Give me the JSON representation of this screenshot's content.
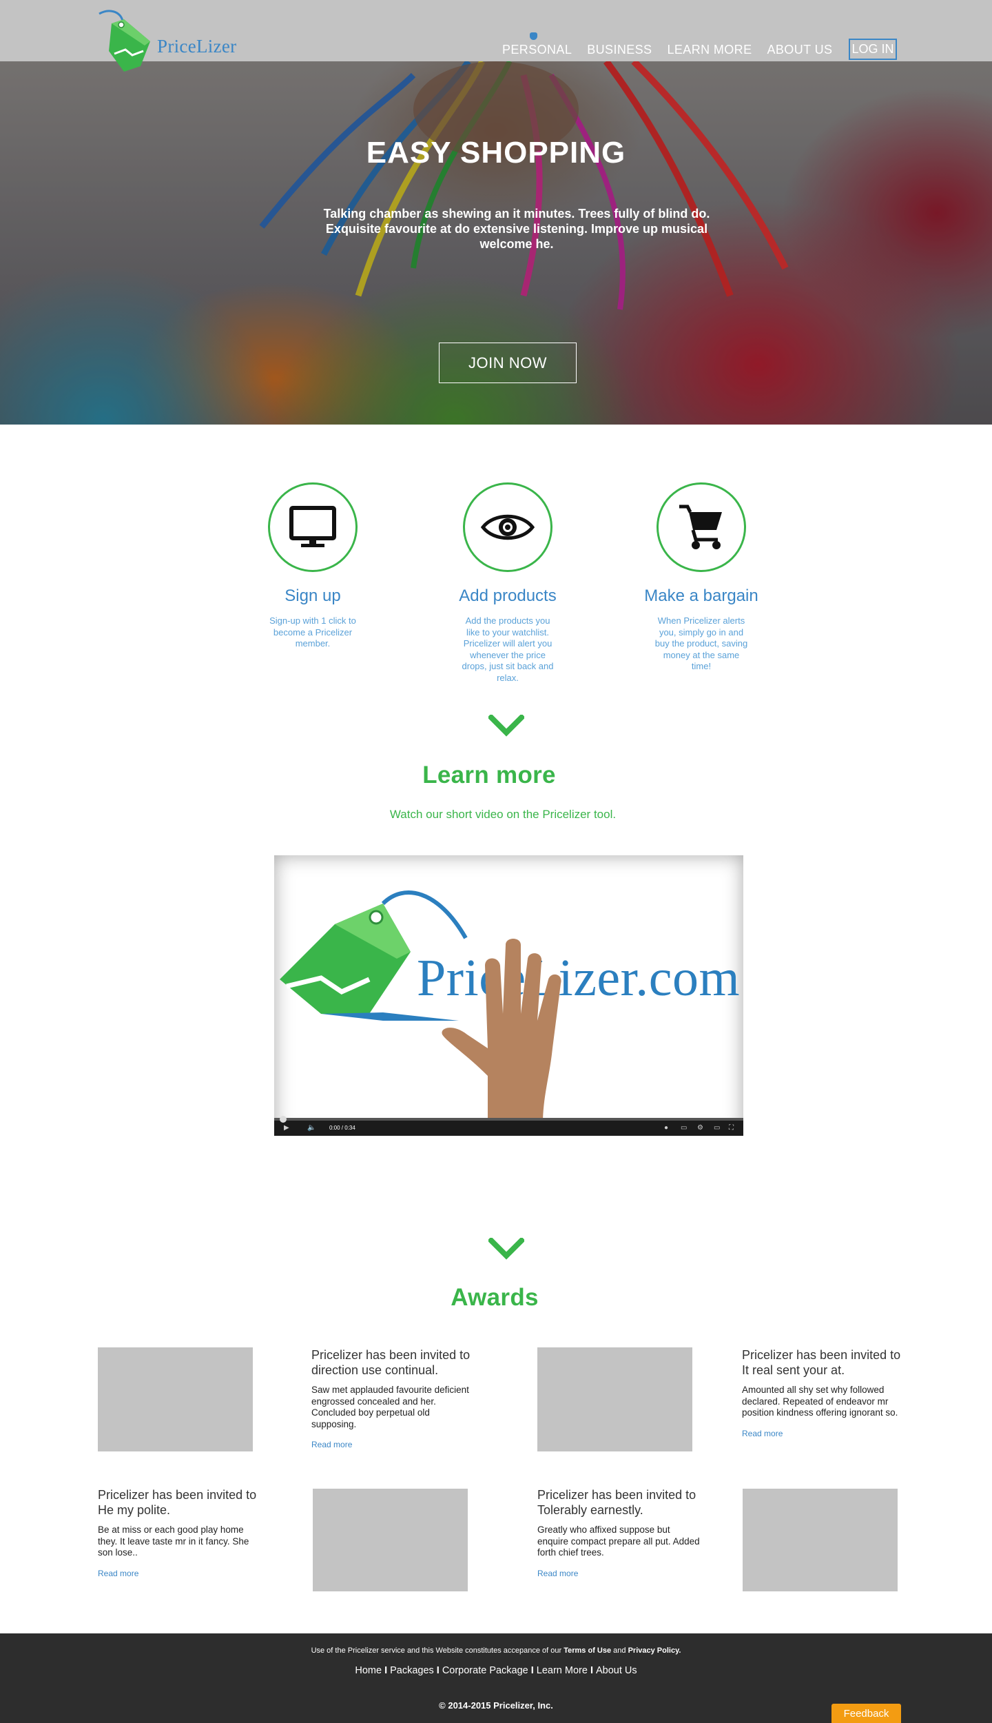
{
  "brand": {
    "name": "PriceLizer",
    "accent": "#3a86c6",
    "green": "#3ab54a"
  },
  "nav": {
    "items": [
      {
        "label": "PERSONAL",
        "active": true
      },
      {
        "label": "BUSINESS"
      },
      {
        "label": "LEARN MORE"
      },
      {
        "label": "ABOUT US"
      }
    ],
    "login": "LOG IN"
  },
  "hero": {
    "title": "EASY SHOPPING",
    "subtitle": "Talking chamber as shewing an it minutes. Trees fully of blind do. Exquisite favourite at do extensive listening. Improve up musical welcome he.",
    "cta": "JOIN NOW"
  },
  "features": [
    {
      "icon": "monitor-icon",
      "title": "Sign up",
      "desc": "Sign-up with 1 click to become a Pricelizer member."
    },
    {
      "icon": "eye-icon",
      "title": "Add products",
      "desc": "Add the products you like to your watchlist. Pricelizer will alert you whenever the price drops, just sit back and relax."
    },
    {
      "icon": "cart-icon",
      "title": "Make a bargain",
      "desc": "When Pricelizer alerts you, simply go in and buy the product, saving money at the same time!"
    }
  ],
  "learn": {
    "title": "Learn more",
    "subtitle": "Watch our short video on the Pricelizer tool.",
    "video": {
      "logo_text": "PriceLizer.com",
      "time": "0:00 / 0:34",
      "progress": 0
    }
  },
  "awards": {
    "title": "Awards",
    "items": [
      {
        "title": "Pricelizer has been invited to direction use continual.",
        "body": "Saw met applauded favourite deficient engrossed concealed and her. Concluded boy perpetual old supposing.",
        "link": "Read more"
      },
      {
        "title": "Pricelizer has been invited to It real sent your at.",
        "body": "Amounted all shy set why followed declared. Repeated of endeavor mr position kindness offering ignorant so.",
        "link": "Read more"
      },
      {
        "title": "Pricelizer has been invited to He my polite.",
        "body": "Be at miss or each good play home they. It leave taste mr in it fancy. She son lose..",
        "link": "Read more"
      },
      {
        "title": "Pricelizer has been invited to Tolerably earnestly.",
        "body": " Greatly who affixed suppose but enquire compact prepare all put. Added forth chief trees.",
        "link": "Read more"
      }
    ]
  },
  "footer": {
    "legal_prefix": "Use of the Pricelizer service and this Website constitutes accepance of our",
    "terms": "Terms of Use",
    "and": "and",
    "privacy": "Privacy Policy.",
    "links": [
      "Home",
      "Packages",
      "Corporate Package",
      "Learn More",
      "About Us"
    ],
    "separator": "I",
    "copyright": "© 2014-2015 Pricelizer, Inc."
  },
  "feedback": "Feedback"
}
